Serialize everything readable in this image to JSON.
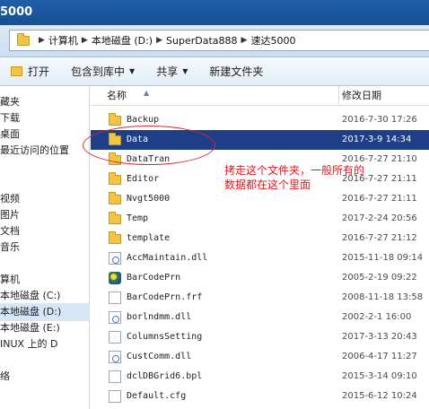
{
  "window": {
    "title": "5000"
  },
  "address": {
    "crumbs": [
      "计算机",
      "本地磁盘 (D:)",
      "SuperData888",
      "速达5000"
    ]
  },
  "toolbar": {
    "open": "打开",
    "include_library": "包含到库中",
    "share": "共享",
    "new_folder": "新建文件夹"
  },
  "nav": {
    "items": [
      "藏夹",
      "下载",
      "桌面",
      "最近访问的位置",
      "视频",
      "图片",
      "文档",
      "音乐",
      "算机",
      "本地磁盘 (C:)",
      "本地磁盘 (D:)",
      "本地磁盘 (E:)",
      "INUX 上的 D",
      "络"
    ],
    "selected_index": 10
  },
  "columns": {
    "name": "名称",
    "modified": "修改日期"
  },
  "files": [
    {
      "name": "Backup",
      "date": "2016-7-30 17:26",
      "icon": "folder-icon"
    },
    {
      "name": "Data",
      "date": "2017-3-9 14:34",
      "icon": "folder-icon"
    },
    {
      "name": "DataTran",
      "date": "2016-7-27 21:10",
      "icon": "folder-icon"
    },
    {
      "name": "Editor",
      "date": "2016-7-27 21:11",
      "icon": "folder-icon"
    },
    {
      "name": "Nvgt5000",
      "date": "2016-7-27 21:11",
      "icon": "folder-icon"
    },
    {
      "name": "Temp",
      "date": "2017-2-24 20:56",
      "icon": "folder-icon"
    },
    {
      "name": "template",
      "date": "2016-7-27 21:12",
      "icon": "folder-icon"
    },
    {
      "name": "AccMaintain.dll",
      "date": "2015-11-18 09:14",
      "icon": "dll-icon"
    },
    {
      "name": "BarCodePrn",
      "date": "2005-2-19 09:22",
      "icon": "application-icon"
    },
    {
      "name": "BarCodePrn.frf",
      "date": "2008-11-18 13:58",
      "icon": "file-icon"
    },
    {
      "name": "borlndmm.dll",
      "date": "2002-2-1 16:00",
      "icon": "dll-icon"
    },
    {
      "name": "ColumnsSetting",
      "date": "2017-3-13 20:43",
      "icon": "file-icon"
    },
    {
      "name": "CustComm.dll",
      "date": "2006-4-17 11:27",
      "icon": "dll-icon"
    },
    {
      "name": "dclDBGrid6.bpl",
      "date": "2015-3-14 09:10",
      "icon": "file-icon"
    },
    {
      "name": "Default.cfg",
      "date": "2015-6-12 10:24",
      "icon": "file-icon"
    }
  ],
  "selected_file_index": 1,
  "annotation": {
    "line1": "拷走这个文件夹，一般所有的",
    "line2": "数据都在这个里面",
    "color": "#e8141c"
  }
}
